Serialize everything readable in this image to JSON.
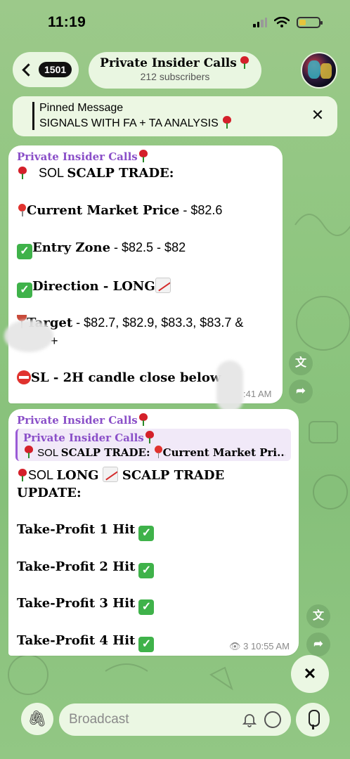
{
  "status": {
    "time": "11:19"
  },
  "header": {
    "back_count": "1501",
    "channel_name": "Private Insider Calls",
    "subscribers": "212 subscribers"
  },
  "pinned": {
    "title": "Pinned Message",
    "text": "SIGNALS WITH FA + TA ANALYSIS"
  },
  "message1": {
    "sender": "Private Insider Calls",
    "title_plain": "SOL ",
    "title_bold": "SCALP TRADE:",
    "price_label": "Current Market Price",
    "price_value": " - $82.6",
    "entry_label": "Entry Zone",
    "entry_value": " - $82.5 - $82",
    "direction_label": "Direction - LONG",
    "target_label": "Target",
    "target_value": " - $82.7,  $82.9, $83.3, $83.7 &",
    "target_cont": "+",
    "sl_label": "SL -  2H candle close  below",
    "time": ":41 AM"
  },
  "message2": {
    "sender": "Private Insider Calls",
    "quote_sender": "Private Insider Calls",
    "quote_plain": " SOL ",
    "quote_bold": "SCALP TRADE:",
    "quote_rest": "Current Market Pri...",
    "update_plain": "SOL ",
    "update_long": "LONG",
    "update_bold": " SCALP TRADE",
    "update_line2": "UPDATE:",
    "tp1": "Take-Profit  1 Hit",
    "tp2": "Take-Profit  2 Hit",
    "tp3": "Take-Profit  3 Hit",
    "tp4": "Take-Profit  4 Hit",
    "views": "3",
    "time": "10:55 AM"
  },
  "input": {
    "placeholder": "Broadcast"
  },
  "colors": {
    "sender": "#8a4fc8",
    "check": "#3fb24a",
    "rose": "#d4202a"
  },
  "icons": [
    "back-chevron-icon",
    "close-icon",
    "translate-icon",
    "forward-icon",
    "attach-icon",
    "bell-icon",
    "timer-icon",
    "mic-icon",
    "eye-icon"
  ]
}
